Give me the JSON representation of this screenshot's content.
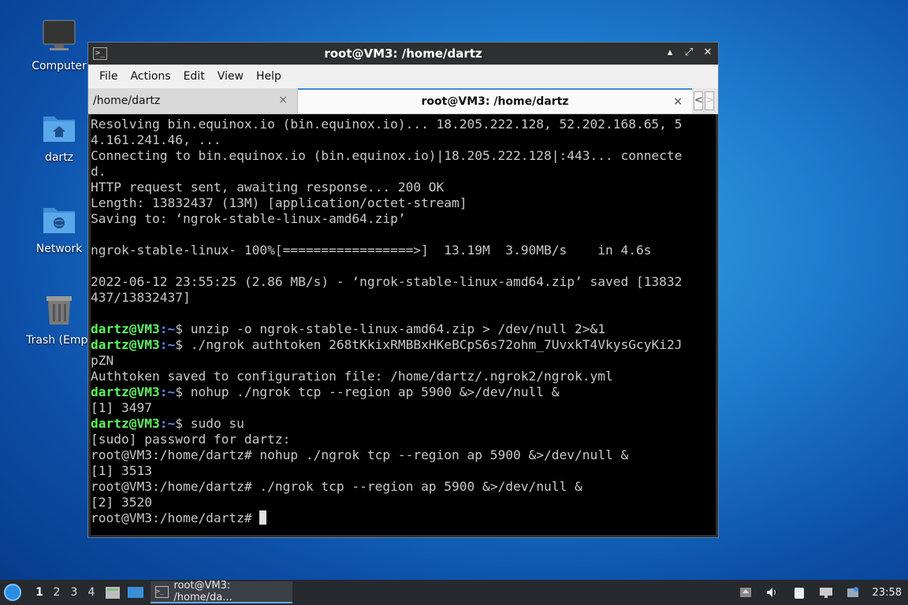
{
  "desktop": {
    "icons": [
      {
        "label": "Computer"
      },
      {
        "label": "dartz"
      },
      {
        "label": "Network"
      },
      {
        "label": "Trash (Empt"
      }
    ]
  },
  "window": {
    "title": "root@VM3: /home/dartz",
    "menu": [
      "File",
      "Actions",
      "Edit",
      "View",
      "Help"
    ],
    "tabs": [
      {
        "label": "/home/dartz",
        "close": "×"
      },
      {
        "label": "root@VM3: /home/dartz",
        "close": "×"
      }
    ],
    "buttons": {
      "minimize": "▴",
      "maximize": "⤢",
      "close": "✕"
    },
    "tab_scroll": {
      "left": "<",
      "right": ">"
    }
  },
  "terminal": {
    "lines": [
      {
        "text": "Resolving bin.equinox.io (bin.equinox.io)... 18.205.222.128, 52.202.168.65, 5"
      },
      {
        "text": "4.161.241.46, ..."
      },
      {
        "text": "Connecting to bin.equinox.io (bin.equinox.io)|18.205.222.128|:443... connecte"
      },
      {
        "text": "d."
      },
      {
        "text": "HTTP request sent, awaiting response... 200 OK"
      },
      {
        "text": "Length: 13832437 (13M) [application/octet-stream]"
      },
      {
        "text": "Saving to: ‘ngrok-stable-linux-amd64.zip’"
      },
      {
        "text": ""
      },
      {
        "text": "ngrok-stable-linux- 100%[=================>]  13.19M  3.90MB/s    in 4.6s"
      },
      {
        "text": ""
      },
      {
        "text": "2022-06-12 23:55:25 (2.86 MB/s) - ‘ngrok-stable-linux-amd64.zip’ saved [13832"
      },
      {
        "text": "437/13832437]"
      },
      {
        "text": ""
      },
      {
        "prompt": "dartz@VM3",
        "path": ":~",
        "text": "$ unzip -o ngrok-stable-linux-amd64.zip > /dev/null 2>&1"
      },
      {
        "prompt": "dartz@VM3",
        "path": ":~",
        "text": "$ ./ngrok authtoken 268tKkixRMBBxHKeBCpS6s72ohm_7UvxkT4VkysGcyKi2J"
      },
      {
        "text": "pZN"
      },
      {
        "text": "Authtoken saved to configuration file: /home/dartz/.ngrok2/ngrok.yml"
      },
      {
        "prompt": "dartz@VM3",
        "path": ":~",
        "text": "$ nohup ./ngrok tcp --region ap 5900 &>/dev/null &"
      },
      {
        "text": "[1] 3497"
      },
      {
        "prompt": "dartz@VM3",
        "path": ":~",
        "text": "$ sudo su"
      },
      {
        "text": "[sudo] password for dartz:"
      },
      {
        "text": "root@VM3:/home/dartz# nohup ./ngrok tcp --region ap 5900 &>/dev/null &"
      },
      {
        "text": "[1] 3513"
      },
      {
        "text": "root@VM3:/home/dartz# ./ngrok tcp --region ap 5900 &>/dev/null &"
      },
      {
        "text": "[2] 3520"
      },
      {
        "text": "root@VM3:/home/dartz# ",
        "cursor": true
      }
    ]
  },
  "taskbar": {
    "workspaces": [
      "1",
      "2",
      "3",
      "4"
    ],
    "active_workspace": "1",
    "task_label": "root@VM3: /home/da...",
    "clock": "23:58"
  }
}
